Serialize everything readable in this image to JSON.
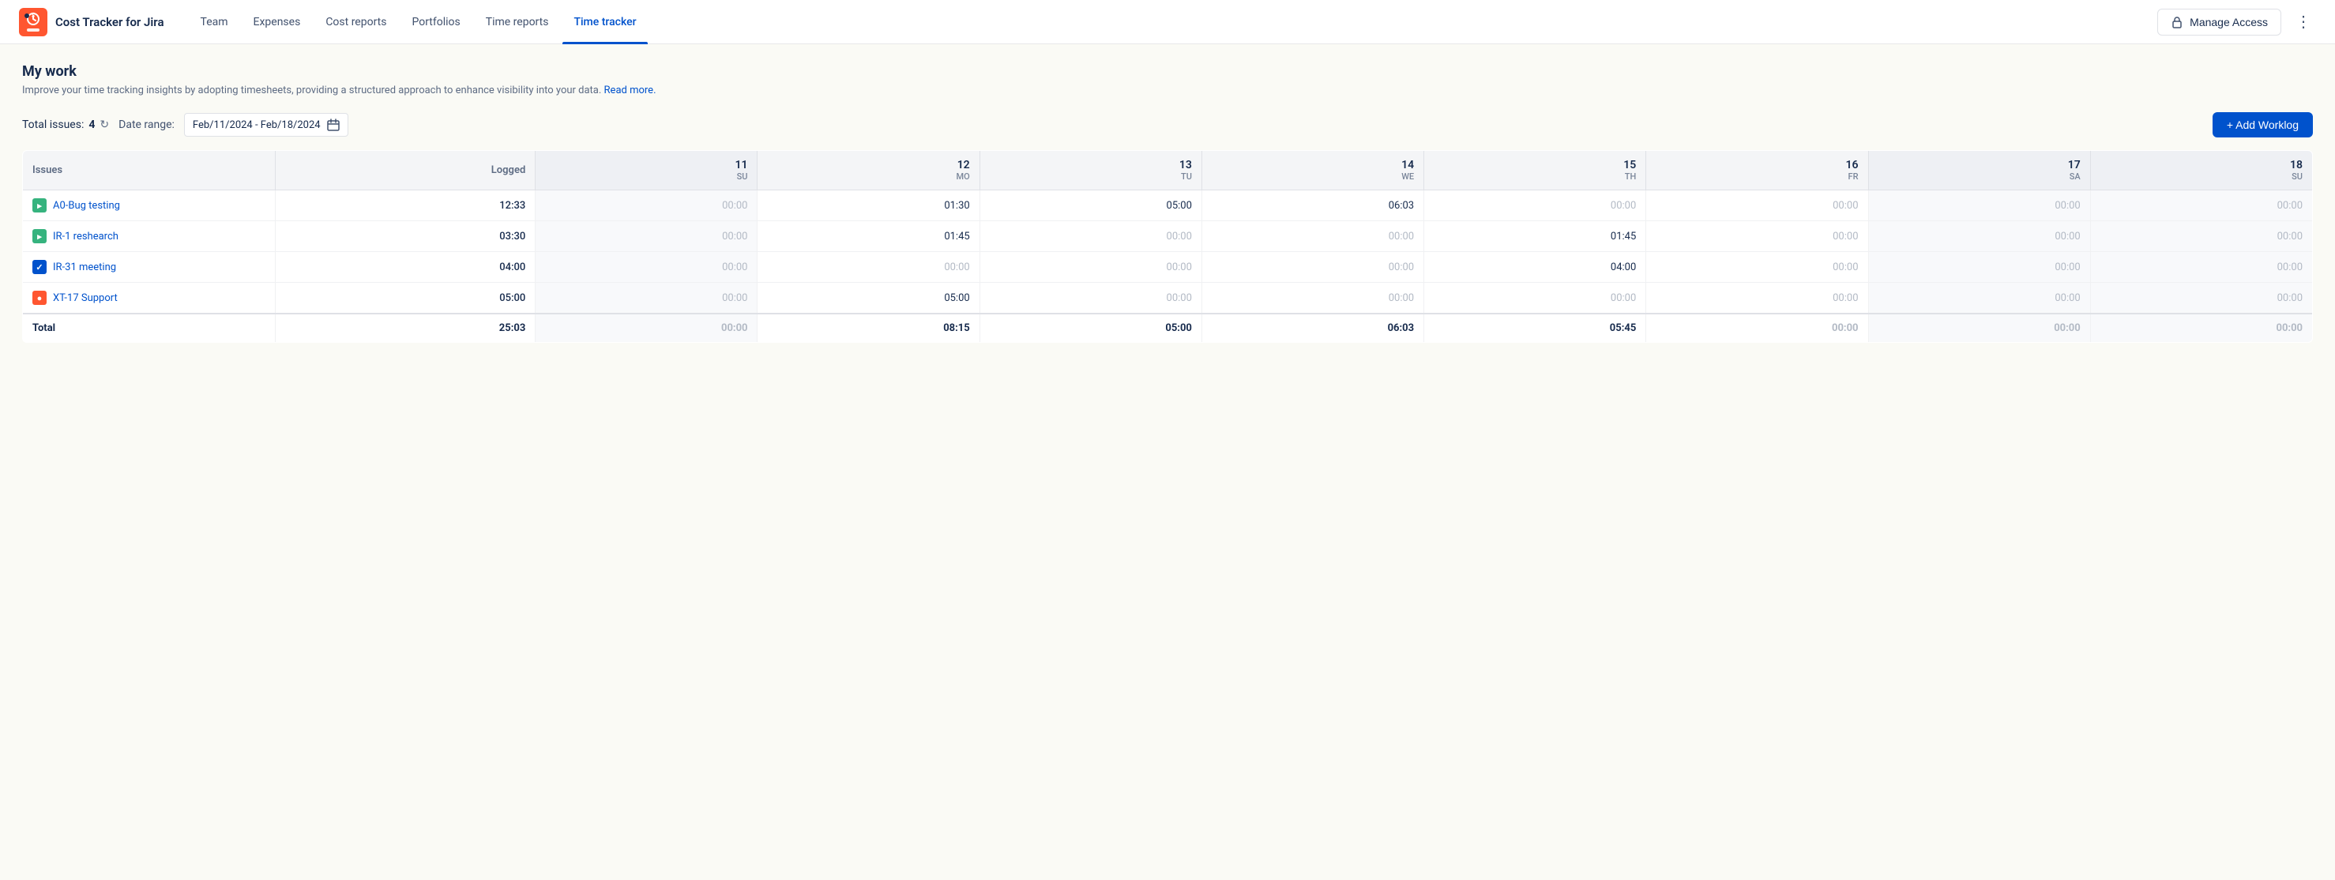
{
  "app": {
    "logo_text": "Cost Tracker for Jira"
  },
  "nav": {
    "items": [
      {
        "id": "team",
        "label": "Team",
        "active": false
      },
      {
        "id": "expenses",
        "label": "Expenses",
        "active": false
      },
      {
        "id": "cost-reports",
        "label": "Cost reports",
        "active": false
      },
      {
        "id": "portfolios",
        "label": "Portfolios",
        "active": false
      },
      {
        "id": "time-reports",
        "label": "Time reports",
        "active": false
      },
      {
        "id": "time-tracker",
        "label": "Time tracker",
        "active": true
      }
    ],
    "manage_access_label": "Manage Access"
  },
  "page": {
    "title": "My work",
    "description": "Improve your time tracking insights by adopting timesheets, providing a structured approach to enhance visibility into your data.",
    "read_more_label": "Read more."
  },
  "toolbar": {
    "total_issues_label": "Total issues:",
    "total_issues_count": "4",
    "date_range_label": "Date range:",
    "date_range_value": "Feb/11/2024 - Feb/18/2024",
    "add_worklog_label": "+ Add Worklog"
  },
  "table": {
    "col_issues": "Issues",
    "col_logged": "Logged",
    "days": [
      {
        "num": "11",
        "abbr": "SU",
        "weekend": true
      },
      {
        "num": "12",
        "abbr": "MO",
        "weekend": false
      },
      {
        "num": "13",
        "abbr": "TU",
        "weekend": false
      },
      {
        "num": "14",
        "abbr": "WE",
        "weekend": false
      },
      {
        "num": "15",
        "abbr": "TH",
        "weekend": false
      },
      {
        "num": "16",
        "abbr": "FR",
        "weekend": false
      },
      {
        "num": "17",
        "abbr": "SA",
        "weekend": true
      },
      {
        "num": "18",
        "abbr": "SU",
        "weekend": true
      }
    ],
    "rows": [
      {
        "id": "A0-Bug testing",
        "label": "A0-Bug testing",
        "icon_type": "story",
        "logged": "12:33",
        "values": [
          "00:00",
          "01:30",
          "05:00",
          "06:03",
          "00:00",
          "00:00",
          "00:00",
          "00:00"
        ]
      },
      {
        "id": "IR-1 reshearch",
        "label": "IR-1 reshearch",
        "icon_type": "story",
        "logged": "03:30",
        "values": [
          "00:00",
          "01:45",
          "00:00",
          "00:00",
          "01:45",
          "00:00",
          "00:00",
          "00:00"
        ]
      },
      {
        "id": "IR-31 meeting",
        "label": "IR-31 meeting",
        "icon_type": "task",
        "logged": "04:00",
        "values": [
          "00:00",
          "00:00",
          "00:00",
          "00:00",
          "04:00",
          "00:00",
          "00:00",
          "00:00"
        ]
      },
      {
        "id": "XT-17 Support",
        "label": "XT-17 Support",
        "icon_type": "bug",
        "logged": "05:00",
        "values": [
          "00:00",
          "05:00",
          "00:00",
          "00:00",
          "00:00",
          "00:00",
          "00:00",
          "00:00"
        ]
      }
    ],
    "total_label": "Total",
    "total_logged": "25:03",
    "total_values": [
      "00:00",
      "08:15",
      "05:00",
      "06:03",
      "05:45",
      "00:00",
      "00:00",
      "00:00"
    ]
  }
}
